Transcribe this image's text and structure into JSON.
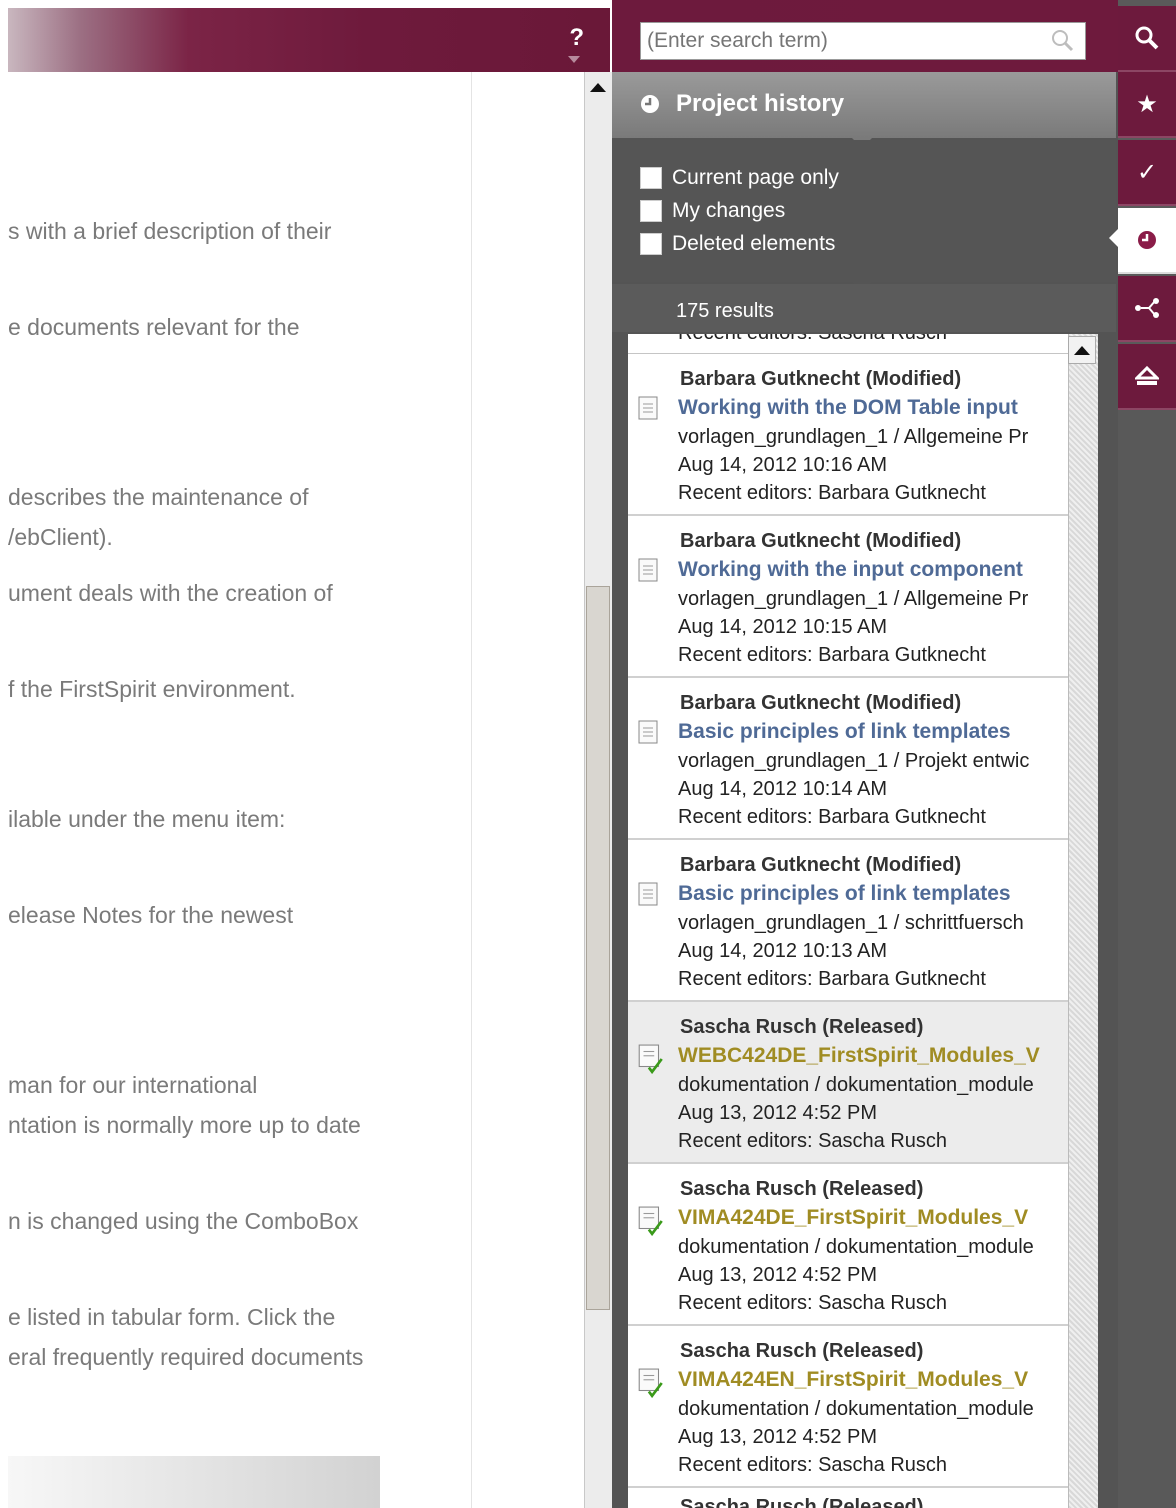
{
  "header": {
    "help_label": "?"
  },
  "documentation": {
    "lines": [
      "s with a brief description of their",
      "e documents relevant for the",
      "describes the maintenance of",
      "/ebClient).",
      "ument deals with the creation of",
      "f the FirstSpirit environment.",
      "ilable under the menu item:",
      "elease Notes for the newest",
      "man for our international",
      "ntation is normally more up to date",
      "n is changed using the ComboBox",
      "e listed in tabular form. Click the",
      "eral frequently required documents"
    ]
  },
  "search": {
    "placeholder": "(Enter search term)"
  },
  "history_panel": {
    "title": "Project history",
    "filters": [
      {
        "label": "Current page only",
        "checked": false
      },
      {
        "label": "My changes",
        "checked": false
      },
      {
        "label": "Deleted elements",
        "checked": false
      }
    ],
    "results_count": "175 results",
    "cut_top_text": "Recent editors: Sascha Rusch",
    "items": [
      {
        "who": "Barbara Gutknecht (Modified)",
        "title": "Working with the DOM Table input",
        "path": "vorlagen_grundlagen_1 / Allgemeine Pr",
        "date": "Aug 14, 2012 10:16 AM",
        "editors": "Recent editors: Barbara Gutknecht",
        "status": "modified"
      },
      {
        "who": "Barbara Gutknecht (Modified)",
        "title": "Working with the input component",
        "path": "vorlagen_grundlagen_1 / Allgemeine Pr",
        "date": "Aug 14, 2012 10:15 AM",
        "editors": "Recent editors: Barbara Gutknecht",
        "status": "modified"
      },
      {
        "who": "Barbara Gutknecht (Modified)",
        "title": "Basic principles of link templates",
        "path": "vorlagen_grundlagen_1 / Projekt entwic",
        "date": "Aug 14, 2012 10:14 AM",
        "editors": "Recent editors: Barbara Gutknecht",
        "status": "modified"
      },
      {
        "who": "Barbara Gutknecht (Modified)",
        "title": "Basic principles of link templates",
        "path": "vorlagen_grundlagen_1 / schrittfuersch",
        "date": "Aug 14, 2012 10:13 AM",
        "editors": "Recent editors: Barbara Gutknecht",
        "status": "modified"
      },
      {
        "who": "Sascha Rusch (Released)",
        "title": "WEBC424DE_FirstSpirit_Modules_V",
        "path": "dokumentation / dokumentation_module",
        "date": "Aug 13, 2012 4:52 PM",
        "editors": "Recent editors: Sascha Rusch",
        "status": "released"
      },
      {
        "who": "Sascha Rusch (Released)",
        "title": "VIMA424DE_FirstSpirit_Modules_V",
        "path": "dokumentation / dokumentation_module",
        "date": "Aug 13, 2012 4:52 PM",
        "editors": "Recent editors: Sascha Rusch",
        "status": "released"
      },
      {
        "who": "Sascha Rusch (Released)",
        "title": "VIMA424EN_FirstSpirit_Modules_V",
        "path": "dokumentation / dokumentation_module",
        "date": "Aug 13, 2012 4:52 PM",
        "editors": "Recent editors: Sascha Rusch",
        "status": "released"
      }
    ],
    "cut_bottom_text": "Sascha Rusch (Released)"
  },
  "rail": {
    "buttons": [
      "search-icon",
      "star-icon",
      "checkmark-icon",
      "history-clock-icon",
      "structure-icon",
      "eject-icon"
    ],
    "active": "history-clock-icon"
  },
  "colors": {
    "brand": "#6d1a3d",
    "modified_title": "#4f6a96",
    "released_title": "#a08c23",
    "panel_bg": "#545454"
  }
}
